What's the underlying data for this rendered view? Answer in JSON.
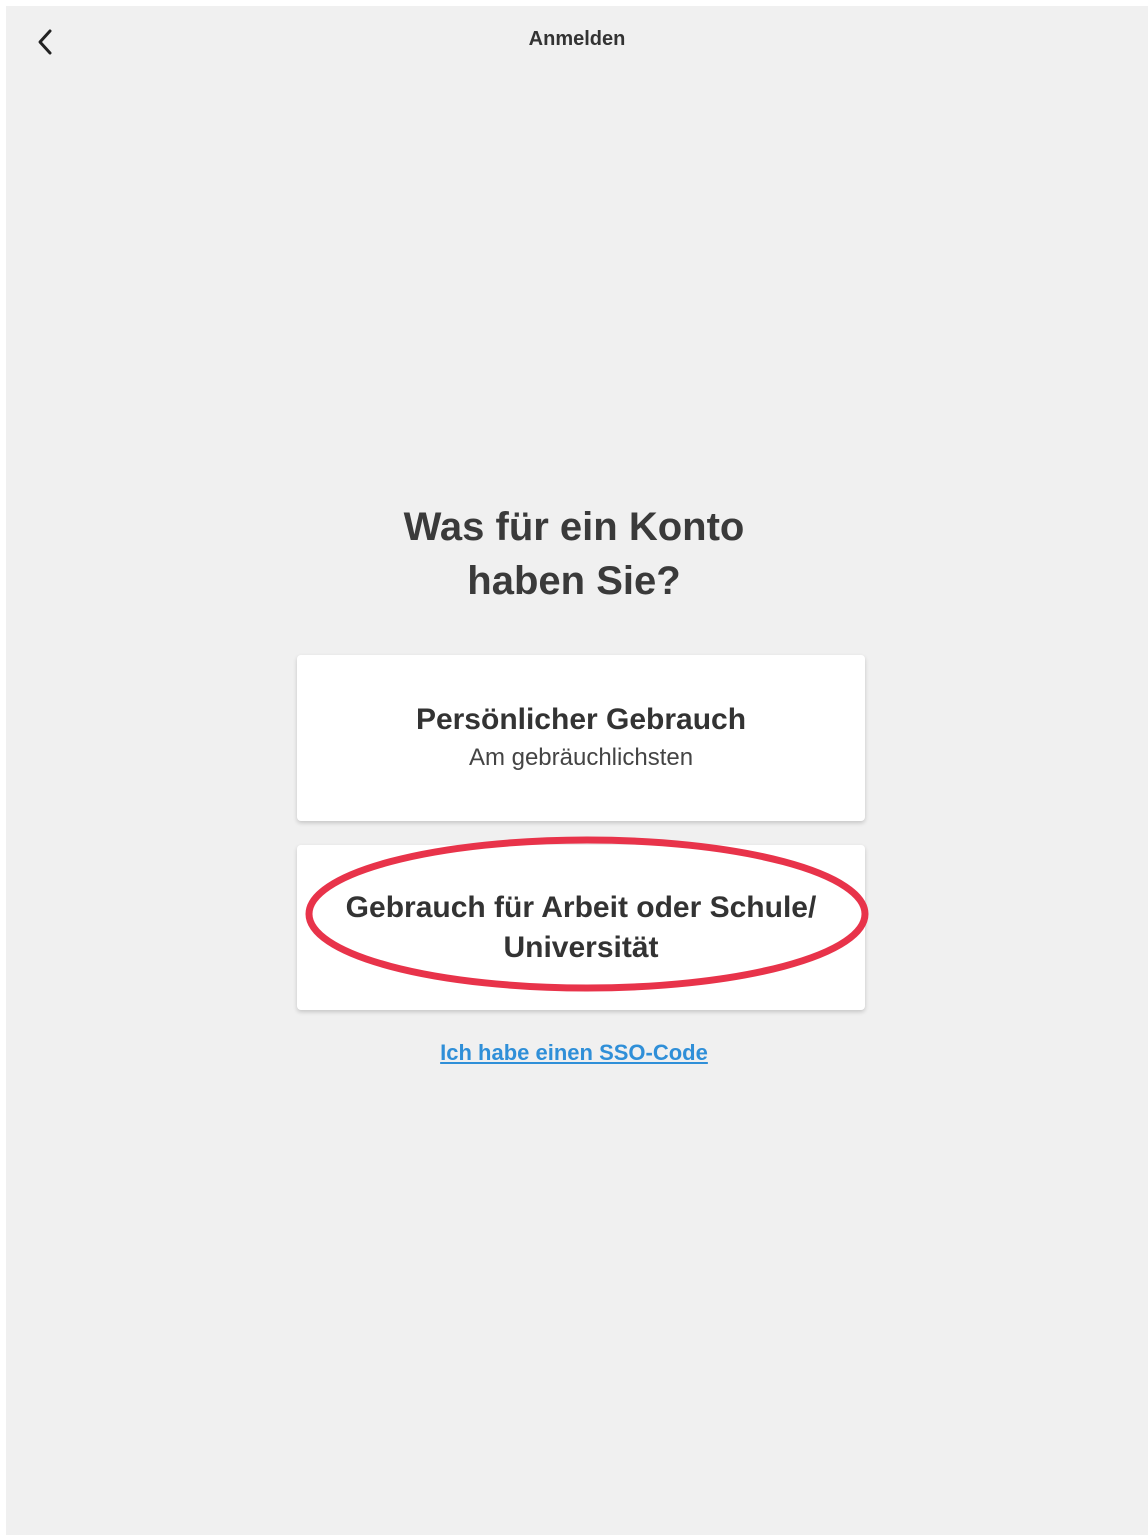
{
  "nav": {
    "title": "Anmelden",
    "back_icon": "chevron-left-icon"
  },
  "heading": {
    "line1": "Was für ein Konto",
    "line2": "haben Sie?"
  },
  "options": [
    {
      "title": "Persönlicher Gebrauch",
      "subtitle": "Am gebräuchlichsten"
    },
    {
      "title": "Gebrauch für Arbeit oder Schule/\nUniversität"
    }
  ],
  "sso_link": "Ich habe einen SSO-Code",
  "colors": {
    "background": "#f0f0f0",
    "link": "#2f8fd8",
    "annotation": "#e8334a"
  }
}
